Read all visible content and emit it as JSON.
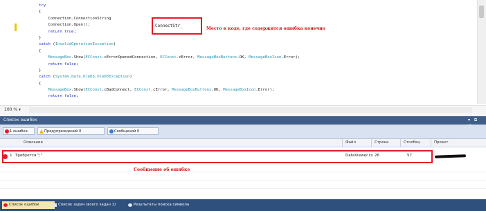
{
  "editor": {
    "code_lines": [
      "try",
      "{",
      "    Connection.ConnectionString  ",
      "    Connection.Open();",
      "    return true;",
      "}",
      "catch (InvalidOperationException)",
      "{",
      "    MessageBox.Show(ECConst.cErrorOpenedConnection, ECConst.cError, MessageBoxButtons.OK, MessageBoxIcon.Error);",
      "    return false;",
      "}",
      "catch (System.Data.OleDb.OleDbException)",
      "{",
      "    MessageBox.Show(ECConst.cBadConnect, ECConst.cError, MessageBoxButtons.OK, MessageBoxIcon.Error);",
      "    return false;"
    ],
    "highlighted_token": "ConnectStr_",
    "zoom": "100 %",
    "zoom_caret": "▾"
  },
  "annotations": {
    "code_note": "Место в коде, где содержится ошибка конечно",
    "row_note": "Сообщение об ошибке"
  },
  "error_list": {
    "title": "Список ошибок",
    "window_controls": "▾ ⧉ ✕",
    "filters": [
      {
        "label": "1 ошибка",
        "icon": "error-icon",
        "color": "#e8182b"
      },
      {
        "label": "Предупреждений 0",
        "icon": "warning-icon",
        "color": "#f2b400"
      },
      {
        "label": "Сообщений 0",
        "icon": "info-icon",
        "color": "#3a7bd5"
      }
    ],
    "columns": [
      "Описание",
      "Файл",
      "Строка",
      "Столбец",
      "Проект"
    ],
    "rows": [
      {
        "index": "1",
        "description": "Требуется \";\"",
        "file": "DataViewer.cs",
        "line": "26",
        "column": "57",
        "project": ""
      }
    ]
  },
  "bottom_tabs": [
    {
      "label": "Список ошибок",
      "active": true
    },
    {
      "label": "Список задач (всего задач 1)",
      "active": false
    },
    {
      "label": "Результаты поиска символа",
      "active": false
    }
  ],
  "colors": {
    "annotation_red": "#e8182b",
    "panel_blue": "#3f5e89",
    "keyword_blue": "#1b2fd1",
    "type_teal": "#2b91af"
  }
}
